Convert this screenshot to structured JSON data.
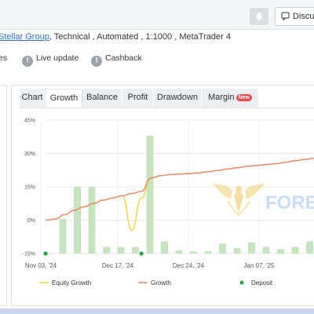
{
  "topbar": {
    "discuss_label": "Discuss"
  },
  "meta": {
    "broker_link": "Stellar Group",
    "details": ", Technical , Automated , 1:1000 , MetaTrader 4"
  },
  "badges": [
    {
      "label": "es",
      "icon": "info-icon"
    },
    {
      "label": "Live update",
      "icon": "info-icon"
    },
    {
      "label": "Cashback",
      "icon": "info-icon"
    }
  ],
  "tabs": [
    {
      "label": "Chart"
    },
    {
      "label": "Growth",
      "active": true
    },
    {
      "label": "Balance"
    },
    {
      "label": "Profit"
    },
    {
      "label": "Drawdown"
    },
    {
      "label": "Margin",
      "badge": "New"
    }
  ],
  "watermark": {
    "text": "FOREX"
  },
  "chart_data": {
    "type": "bar",
    "y_ticks": [
      "45%",
      "30%",
      "15%",
      "0%",
      "-15%"
    ],
    "ylim": [
      -15,
      45
    ],
    "x_ticks": [
      "Nov 03, '24",
      "Dec 17, '24",
      "Dec 24, '24",
      "Jan 07, '25"
    ],
    "grid": true,
    "legend_position": "bottom",
    "series": [
      {
        "name": "Equity Growth",
        "kind": "line",
        "color": "#f2d33a",
        "values": [
          0.0,
          0.5,
          2.5,
          4.5,
          6.0,
          7.5,
          9.0,
          10.0,
          11.0,
          -4.5,
          10.0,
          19.0,
          20.0,
          20.5,
          20.7,
          21.0,
          21.3,
          21.8,
          22.4,
          23.0,
          23.6,
          24.2,
          24.6,
          25.0,
          25.4,
          26.0,
          26.7,
          27.3,
          27.8
        ]
      },
      {
        "name": "Growth",
        "kind": "line",
        "color": "#e8866a",
        "values": [
          0.0,
          0.5,
          2.5,
          4.5,
          6.0,
          7.5,
          9.0,
          10.0,
          11.0,
          12.0,
          13.0,
          19.0,
          20.0,
          20.5,
          20.7,
          21.0,
          21.3,
          21.8,
          22.4,
          23.0,
          23.6,
          24.2,
          24.6,
          25.0,
          25.4,
          26.0,
          26.7,
          27.3,
          27.8
        ]
      },
      {
        "name": "Deposit",
        "kind": "point",
        "color": "#25a244",
        "values": [
          -15,
          null,
          null,
          null,
          null,
          null,
          null,
          null,
          null,
          null,
          -15,
          null,
          null,
          null,
          null,
          null,
          null,
          null,
          null,
          null,
          null,
          null,
          null,
          null,
          null,
          null,
          null,
          null,
          null
        ]
      }
    ],
    "bars": {
      "color": "#c6e4bf",
      "values": [
        null,
        0.5,
        15.0,
        15.0,
        -12.0,
        -12.0,
        -12.0,
        38.0,
        -9.5,
        -13.5,
        -14.0,
        -14.0,
        -10.5,
        -12.5,
        -10.0,
        -12.0,
        -13.0,
        -12.0,
        -9.5,
        -11.5
      ]
    }
  }
}
